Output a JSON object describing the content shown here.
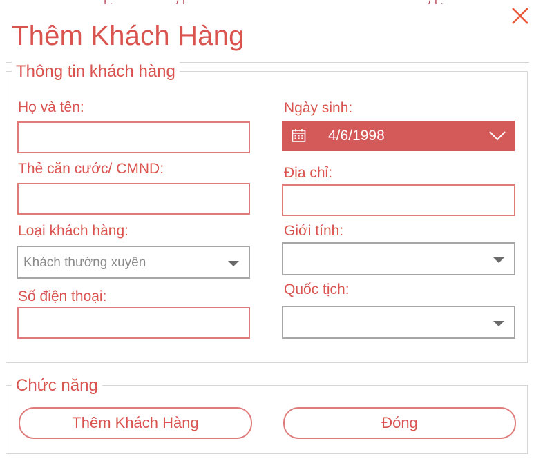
{
  "dialog": {
    "title": "Thêm Khách Hàng"
  },
  "customer_info": {
    "legend": "Thông tin khách hàng",
    "name_label": "Họ và tên:",
    "name_value": "",
    "id_label": "Thẻ căn cước/ CMND:",
    "id_value": "",
    "type_label": "Loại khách hàng:",
    "type_value": "Khách thường xuyên",
    "phone_label": "Số điện thoại:",
    "phone_value": "",
    "birthdate_label": "Ngày sinh:",
    "birthdate_value": "4/6/1998",
    "address_label": "Địa chỉ:",
    "address_value": "",
    "gender_label": "Giới tính:",
    "gender_value": "",
    "nationality_label": "Quốc tịch:",
    "nationality_value": ""
  },
  "functions": {
    "legend": "Chức năng",
    "add_label": "Thêm Khách Hàng",
    "close_label": "Đóng"
  },
  "icons": {
    "close": "close-icon",
    "calendar": "calendar-icon",
    "chevron": "chevron-down-icon",
    "dropdown": "dropdown-arrow-icon"
  },
  "colors": {
    "accent": "#d9534f",
    "field_border": "#e07b7b",
    "datepicker_bg": "#d45a5a",
    "combo_border": "#a6a6a6",
    "group_border": "#d6d6d6"
  }
}
